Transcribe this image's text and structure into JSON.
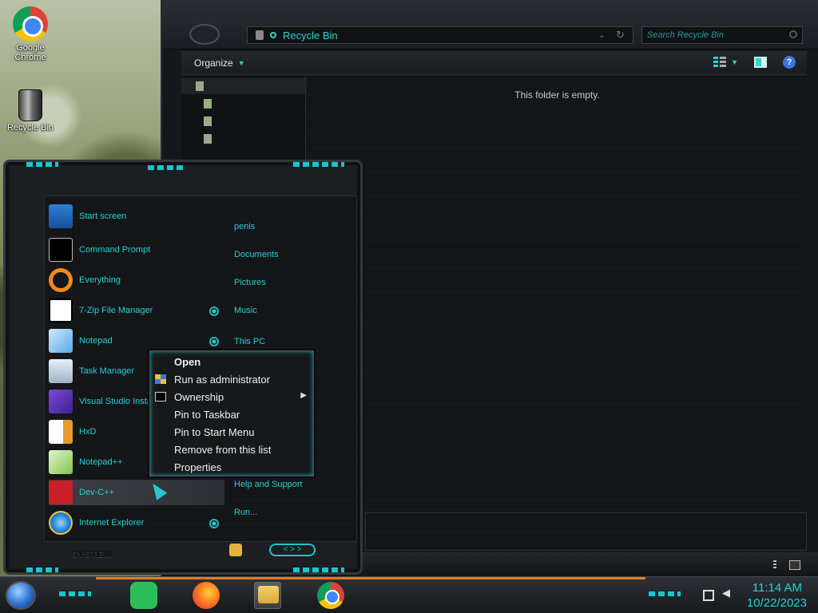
{
  "desktop": {
    "icons": [
      {
        "label": "Google Chrome",
        "icon": "chrome-icon"
      },
      {
        "label": "Recycle Bin",
        "icon": "recycle-bin-icon"
      }
    ]
  },
  "explorer": {
    "address": "Recycle Bin",
    "search_placeholder": "Search Recycle Bin",
    "organize_label": "Organize",
    "empty_message": "This folder is empty."
  },
  "start_menu": {
    "programs": [
      {
        "label": "Start screen",
        "icon": "start-screen-icon"
      },
      {
        "label": "Command Prompt",
        "icon": "command-prompt-icon"
      },
      {
        "label": "Everything",
        "icon": "magnifier-icon"
      },
      {
        "label": "7-Zip File Manager",
        "icon": "7zip-icon"
      },
      {
        "label": "Notepad",
        "icon": "notepad-icon"
      },
      {
        "label": "Task Manager",
        "icon": "task-manager-icon"
      },
      {
        "label": "Visual Studio Insta",
        "icon": "visual-studio-icon"
      },
      {
        "label": "HxD",
        "icon": "hxd-icon"
      },
      {
        "label": "Notepad++",
        "icon": "notepad-plus-plus-icon"
      },
      {
        "label": "Dev-C++",
        "icon": "dev-cpp-icon"
      },
      {
        "label": "Internet Explorer",
        "icon": "internet-explorer-icon"
      }
    ],
    "links": [
      "penis",
      "Documents",
      "Pictures",
      "Music",
      "This PC",
      "Help and Support",
      "Run..."
    ],
    "system_label": "SYSTEM"
  },
  "context_menu": {
    "items": [
      {
        "label": "Open"
      },
      {
        "label": "Run as administrator"
      },
      {
        "label": "Ownership"
      },
      {
        "label": "Pin to Taskbar"
      },
      {
        "label": "Pin to Start Menu"
      },
      {
        "label": "Remove from this list"
      },
      {
        "label": "Properties"
      }
    ]
  },
  "taskbar": {
    "apps": [
      "app-green-icon",
      "firefox-icon",
      "file-explorer-icon",
      "chrome-icon"
    ],
    "time": "11:14 AM",
    "date": "10/22/2023"
  },
  "colors": {
    "accent": "#27d1d6",
    "taskbar_stripe": "#e0792a",
    "window_bg": "#15171a"
  }
}
